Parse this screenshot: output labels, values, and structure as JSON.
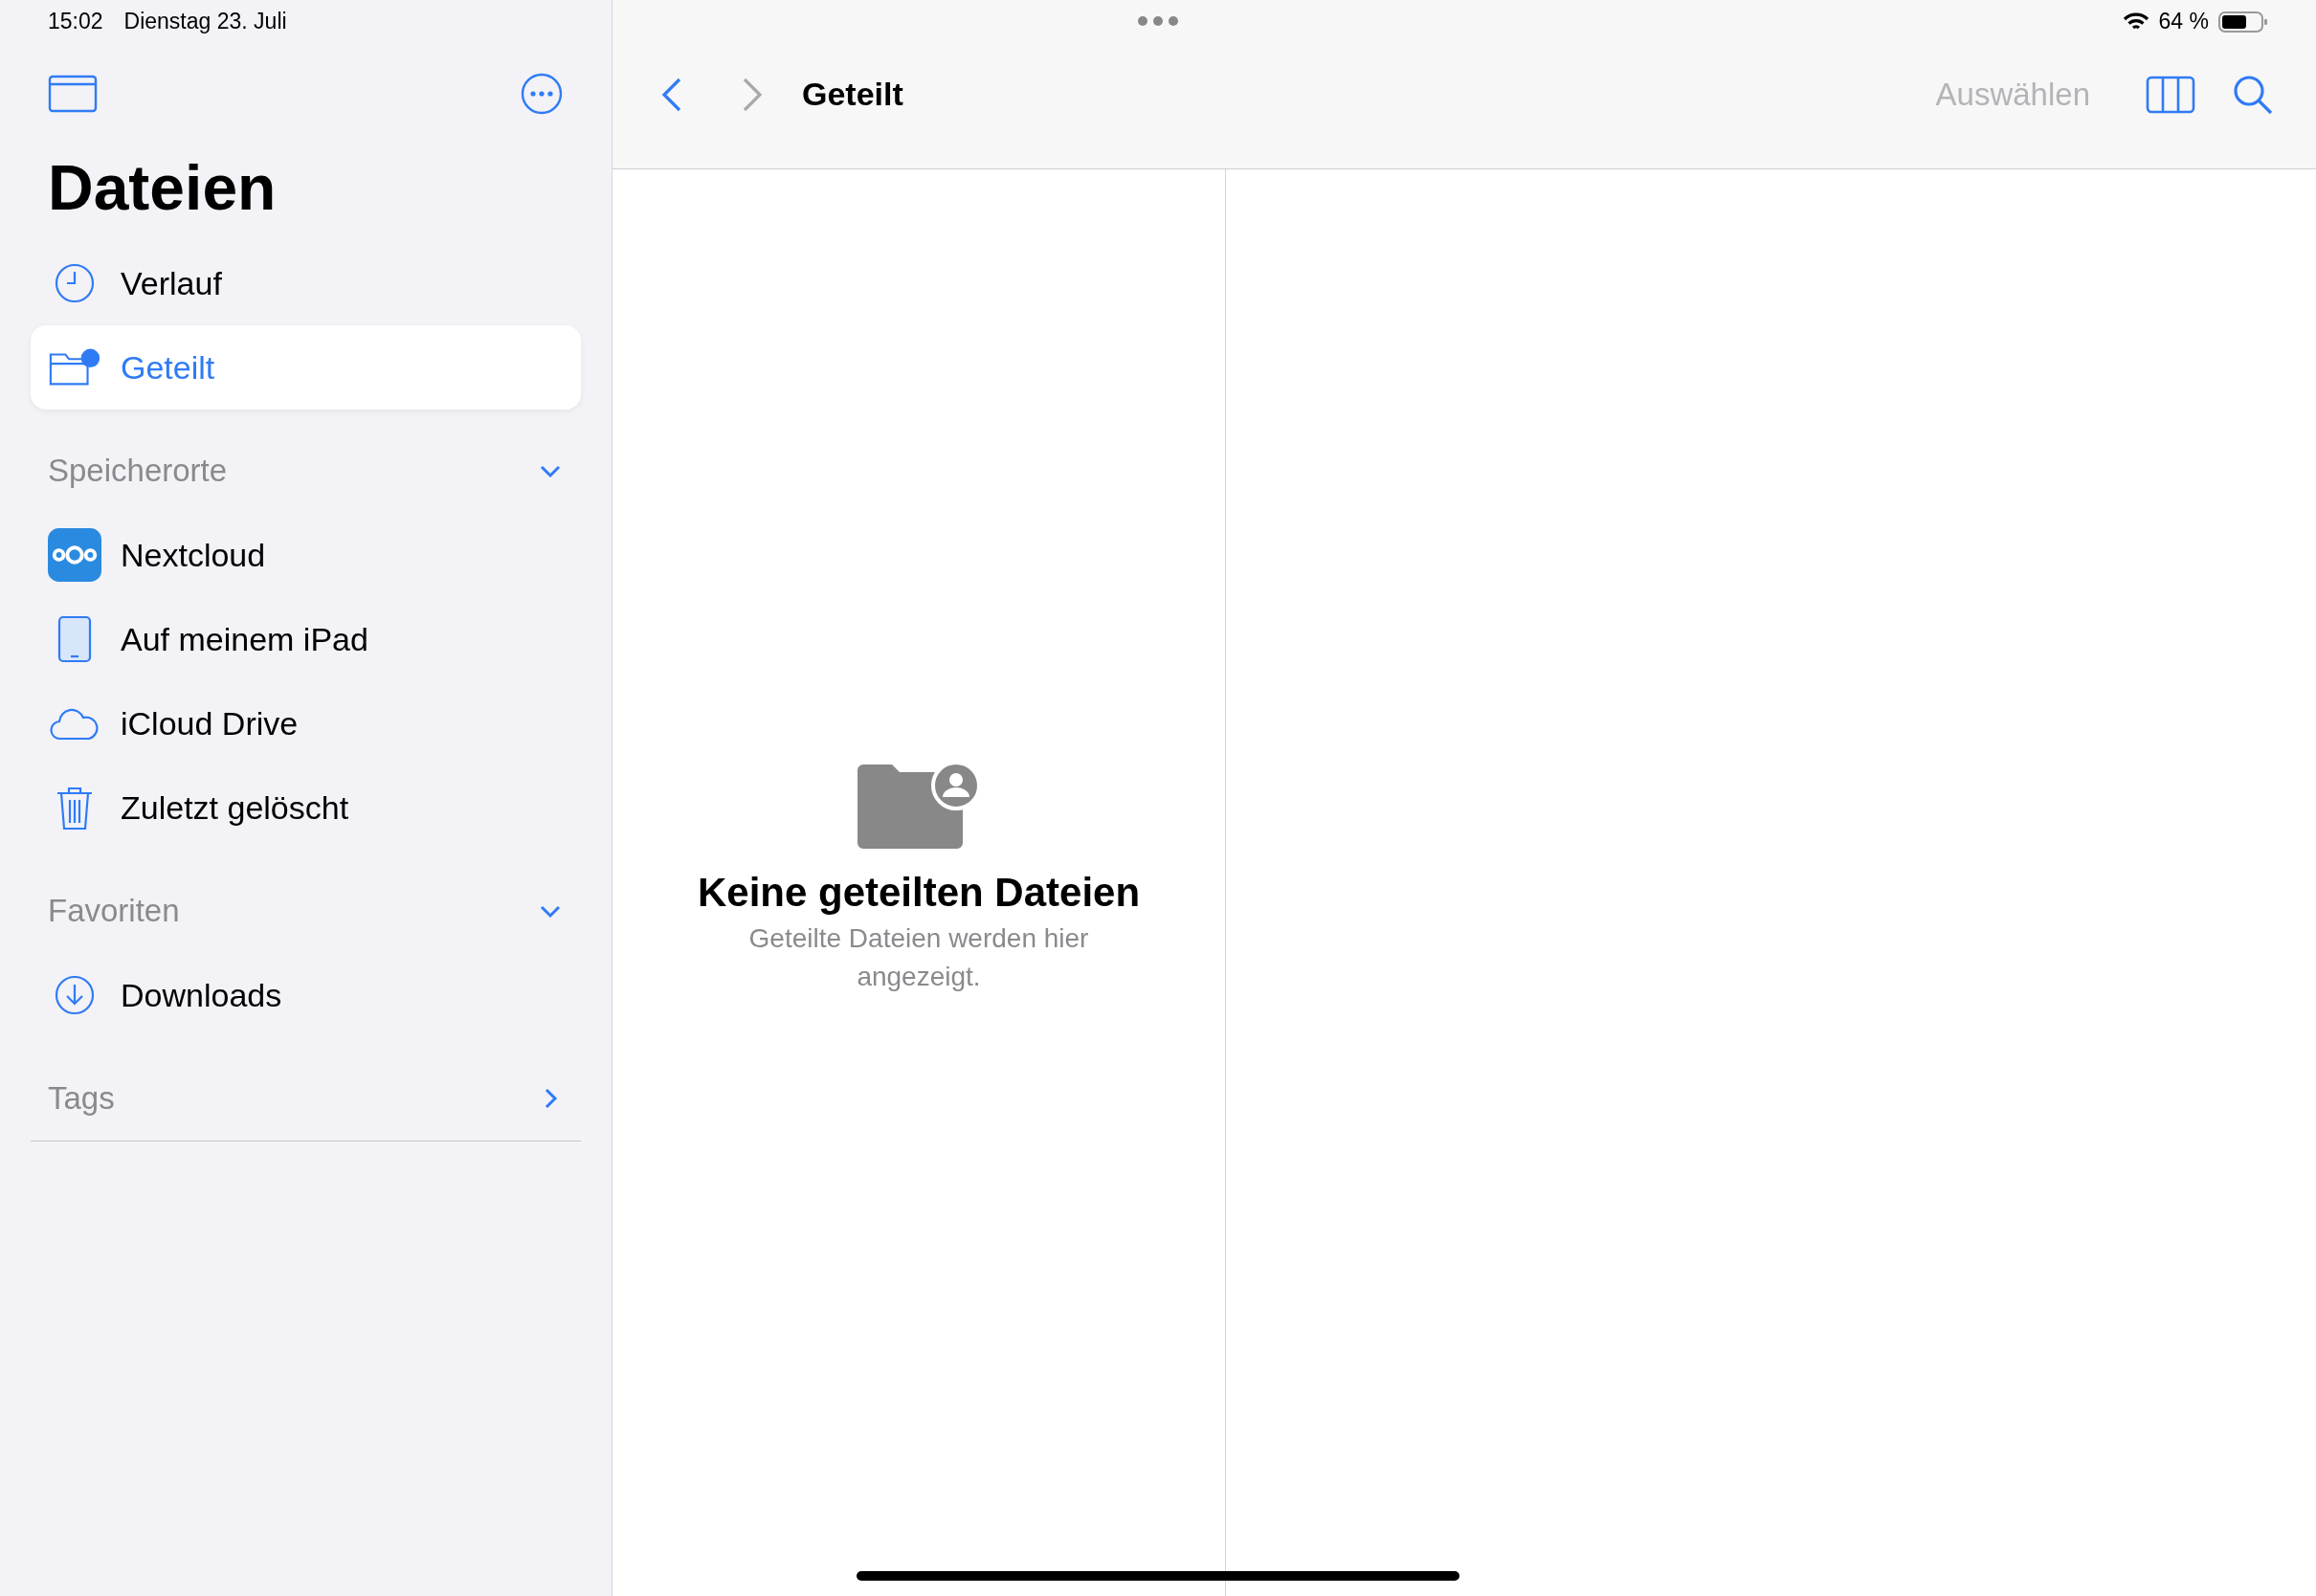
{
  "status_bar": {
    "time": "15:02",
    "date": "Dienstag 23. Juli",
    "battery_text": "64 %",
    "battery": {
      "level": 0.64
    }
  },
  "sidebar": {
    "title": "Dateien",
    "items": [
      {
        "label": "Verlauf",
        "kind": "clock",
        "selected": false
      },
      {
        "label": "Geteilt",
        "kind": "shared",
        "selected": true
      }
    ],
    "sections": [
      {
        "title": "Speicherorte",
        "expanded": true,
        "items": [
          {
            "label": "Nextcloud",
            "kind": "nextcloud",
            "selected": false
          },
          {
            "label": "Auf meinem iPad",
            "kind": "ipad",
            "selected": false
          },
          {
            "label": "iCloud Drive",
            "kind": "cloud",
            "selected": false
          },
          {
            "label": "Zuletzt gelöscht",
            "kind": "trash",
            "selected": false
          }
        ]
      },
      {
        "title": "Favoriten",
        "expanded": true,
        "items": [
          {
            "label": "Downloads",
            "kind": "download",
            "selected": false
          }
        ]
      },
      {
        "title": "Tags",
        "expanded": false
      }
    ]
  },
  "toolbar": {
    "title": "Geteilt",
    "select_button": {
      "label": "Auswählen",
      "disabled": true
    }
  },
  "empty_state": {
    "title": "Keine geteilten Dateien",
    "message": "Geteilte Dateien werden hier angezeigt."
  }
}
